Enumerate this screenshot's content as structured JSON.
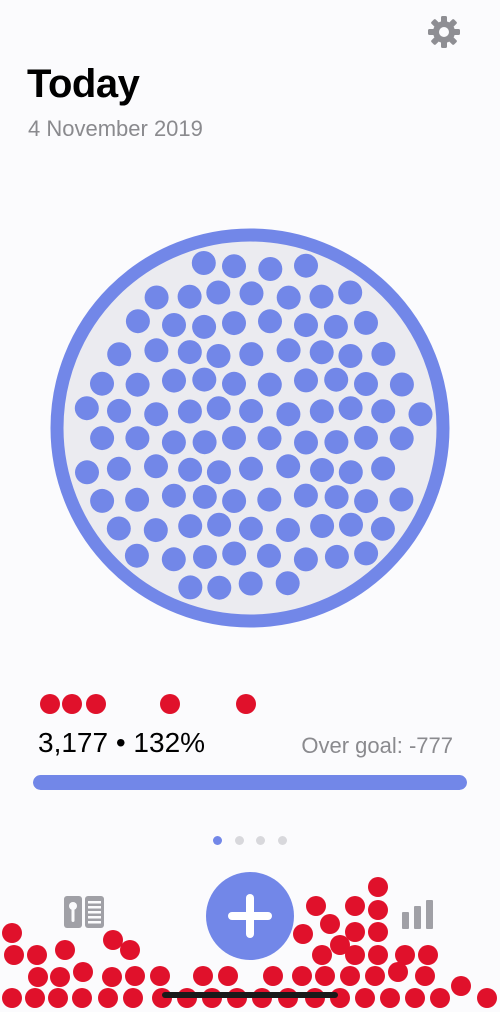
{
  "header": {
    "title": "Today",
    "date": "4 November 2019"
  },
  "summary": {
    "progress_text": "3,177 • 132%",
    "over_goal_text": "Over goal: -777",
    "progress_fraction": 1.0
  },
  "pager": {
    "count": 4,
    "active_index": 0
  },
  "icons": {
    "settings": "gear-icon",
    "diary": "diary-icon",
    "add": "plus-icon",
    "stats": "bar-chart-icon"
  },
  "colors": {
    "accent": "#7287e8",
    "jar_fill": "#ebebf0",
    "dot_red": "#e0112b",
    "secondary_text": "#8a8a8e"
  }
}
